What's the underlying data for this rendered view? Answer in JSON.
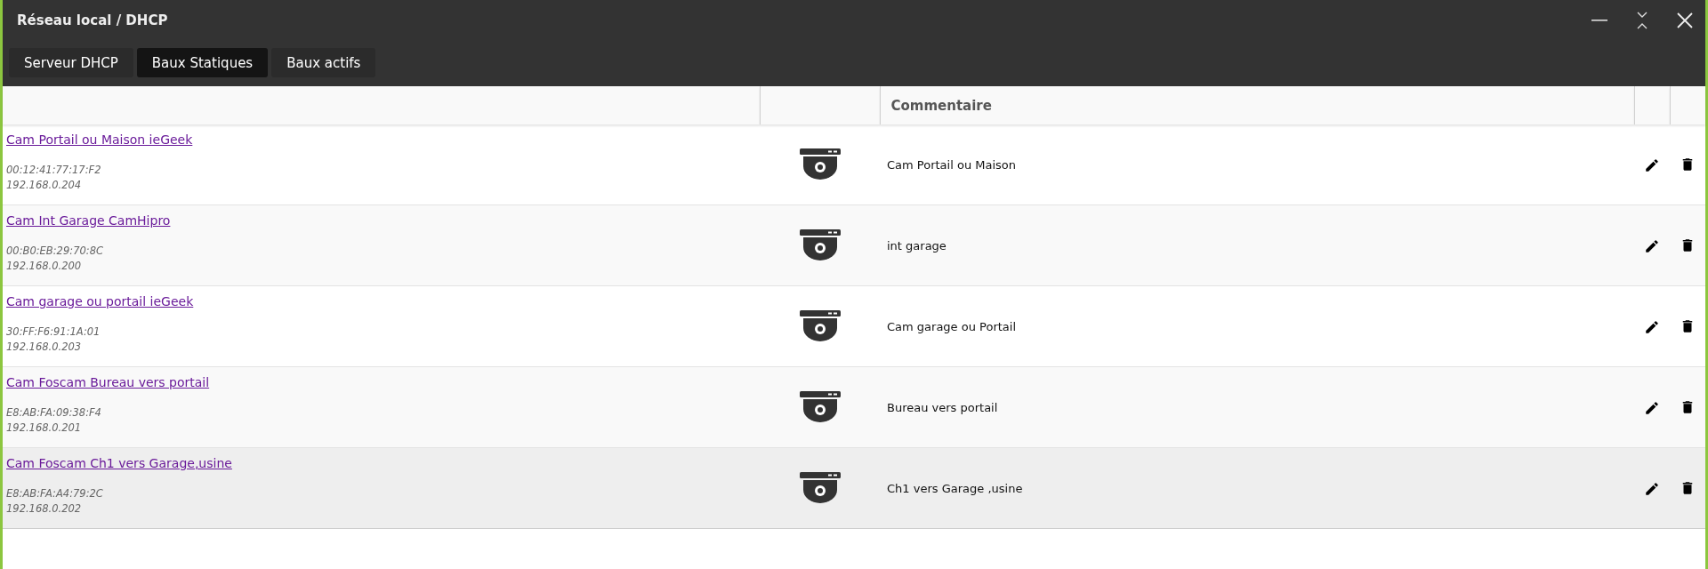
{
  "window": {
    "title": "Réseau local / DHCP"
  },
  "tabs": [
    {
      "label": "Serveur DHCP",
      "selected": false
    },
    {
      "label": "Baux Statiques",
      "selected": true
    },
    {
      "label": "Baux actifs",
      "selected": false
    }
  ],
  "table": {
    "comment_column": {
      "label": "Commentaire"
    },
    "rows": [
      {
        "name": "Cam Portail ou Maison ieGeek",
        "mac": "00:12:41:77:17:F2",
        "ip": "192.168.0.204",
        "comment": "Cam Portail ou Maison",
        "highlighted": false
      },
      {
        "name": "Cam Int Garage CamHipro",
        "mac": "00:B0:EB:29:70:8C",
        "ip": "192.168.0.200",
        "comment": "int garage",
        "highlighted": false
      },
      {
        "name": "Cam garage ou portail ieGeek",
        "mac": "30:FF:F6:91:1A:01",
        "ip": "192.168.0.203",
        "comment": "Cam garage ou Portail",
        "highlighted": false
      },
      {
        "name": "Cam Foscam Bureau vers portail",
        "mac": "E8:AB:FA:09:38:F4",
        "ip": "192.168.0.201",
        "comment": "Bureau vers portail",
        "highlighted": false
      },
      {
        "name": "Cam Foscam Ch1 vers Garage,usine",
        "mac": "E8:AB:FA:A4:79:2C",
        "ip": "192.168.0.202",
        "comment": "Ch1 vers Garage ,usine",
        "highlighted": true
      }
    ]
  }
}
